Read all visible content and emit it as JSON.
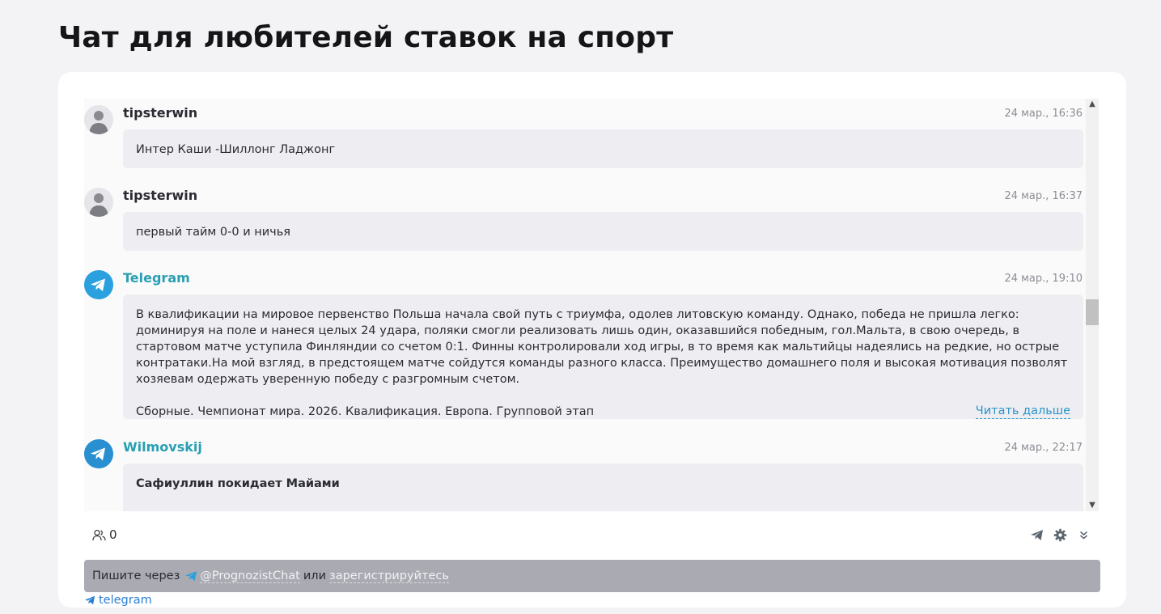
{
  "page": {
    "title": "Чат для любителей ставок на спорт"
  },
  "messages": [
    {
      "author": "tipsterwin",
      "time": "24 мар., 16:36",
      "text": "Интер Каши -Шиллонг Ладжонг"
    },
    {
      "author": "tipsterwin",
      "time": "24 мар., 16:37",
      "text": "первый тайм 0-0 и ничья"
    },
    {
      "author": "Telegram",
      "time": "24 мар., 19:10",
      "text": "В квалификации на мировое первенство Польша начала свой путь с триумфа, одолев литовскую команду. Однако, победа не пришла легко: доминируя на поле и нанеся целых 24 удара, поляки смогли реализовать лишь один, оказавшийся победным, гол.Мальта, в свою очередь, в стартовом матче уступила Финляндии со счетом 0:1. Финны контролировали ход игры, в то время как мальтийцы надеялись на редкие, но острые контратаки.На мой взгляд, в предстоящем матче сойдутся команды разного класса. Преимущество домашнего поля и высокая мотивация позволят хозяевам одержать уверенную победу с разгромным счетом.",
      "text2": "Сборные. Чемпионат мира. 2026. Квалификация. Европа. Групповой этап",
      "read_more": "Читать дальше"
    },
    {
      "author": "Wilmovskij",
      "time": "24 мар., 22:17",
      "text": "Сафиуллин покидает Майами"
    }
  ],
  "toolbar": {
    "users_count": "0"
  },
  "compose": {
    "prefix": "Пишите через",
    "handle": "@PrognozistChat",
    "middle": "или",
    "register": "зарегистрируйтесь"
  },
  "footer": {
    "telegram_label": "telegram"
  },
  "colors": {
    "accent": "#2aa1de",
    "link": "#2a9fb3"
  }
}
